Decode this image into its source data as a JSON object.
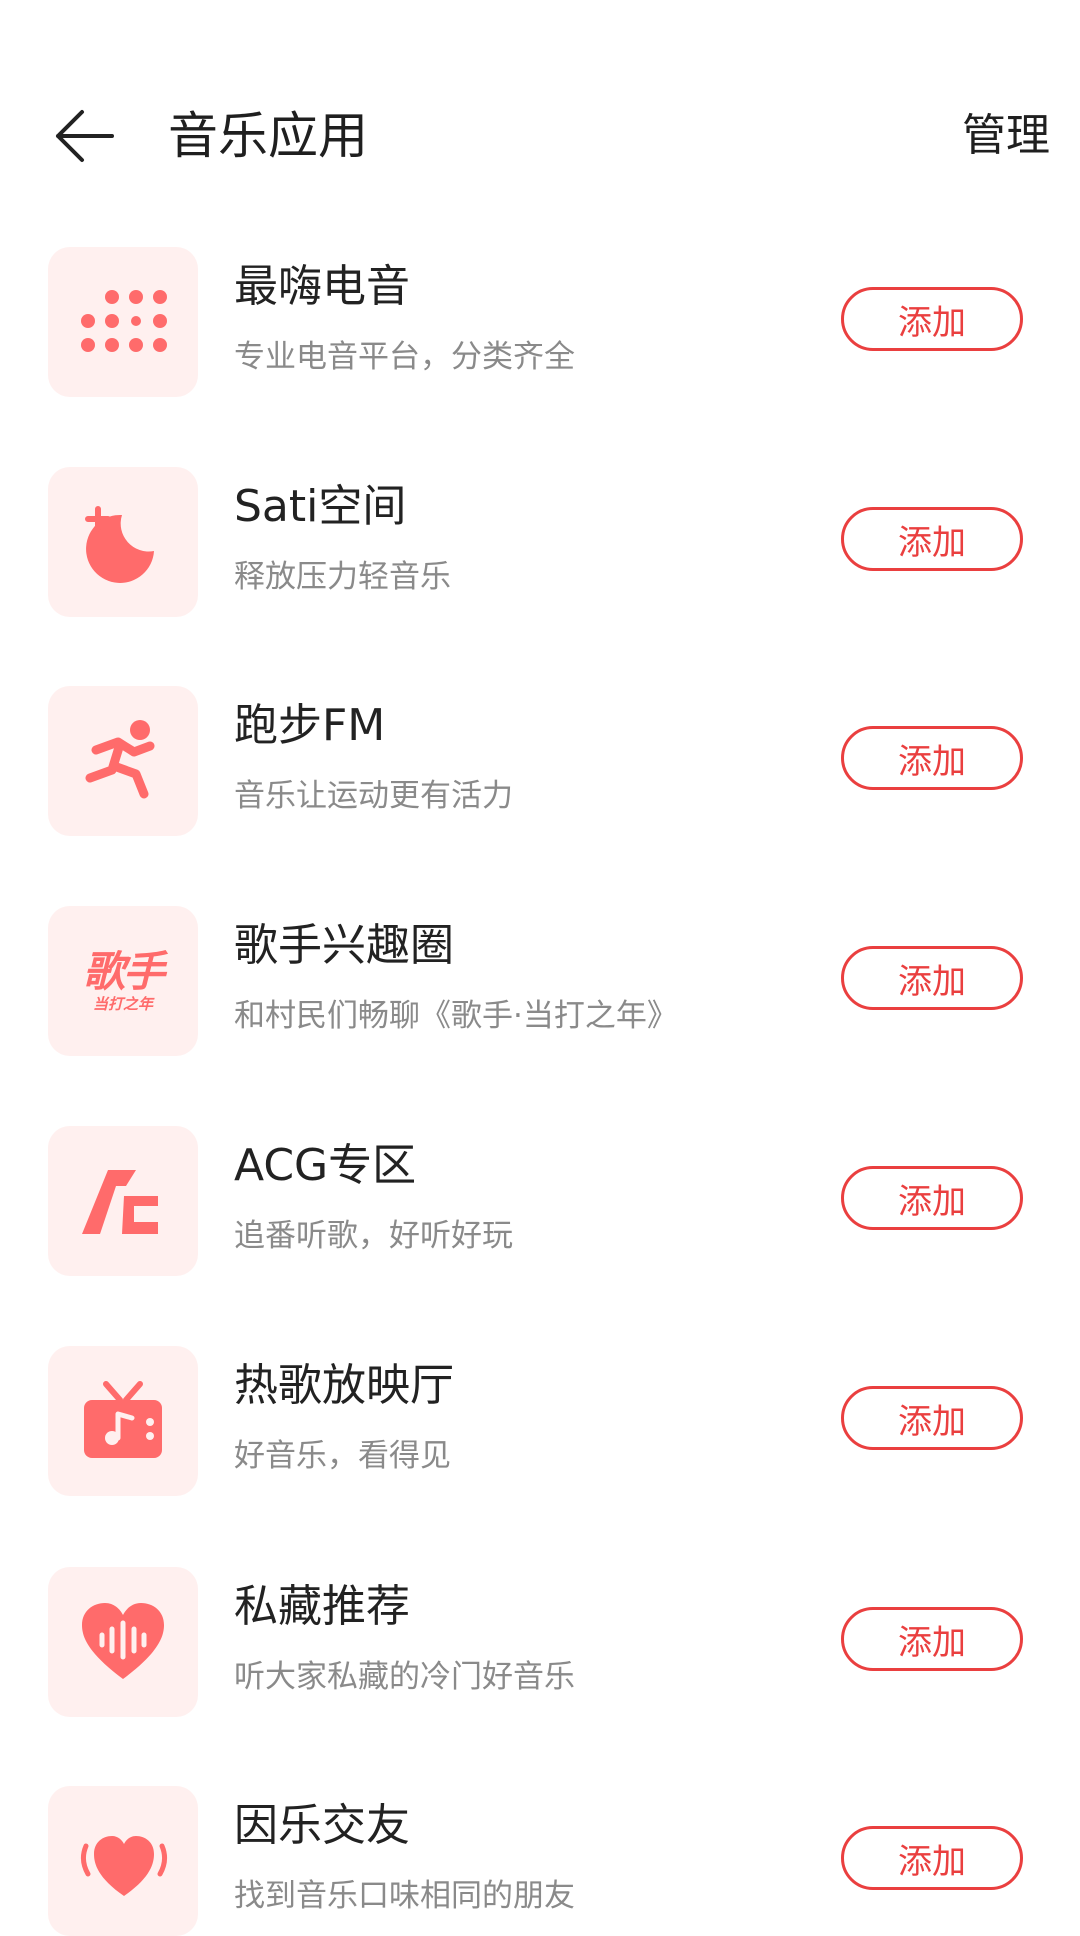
{
  "header": {
    "title": "音乐应用",
    "manage_label": "管理"
  },
  "accent_color": "#ea3f3f",
  "icon_color": "#ff6b6b",
  "tile_color": "#fff0ef",
  "apps": [
    {
      "name": "最嗨电音",
      "desc": "专业电音平台，分类齐全",
      "add_label": "添加",
      "icon": "dots-grid-icon"
    },
    {
      "name": "Sati空间",
      "desc": "释放压力轻音乐",
      "add_label": "添加",
      "icon": "moon-plus-icon"
    },
    {
      "name": "跑步FM",
      "desc": "音乐让运动更有活力",
      "add_label": "添加",
      "icon": "running-person-icon"
    },
    {
      "name": "歌手兴趣圈",
      "desc": "和村民们畅聊《歌手·当打之年》",
      "add_label": "添加",
      "icon": "singer-logo-icon",
      "icon_text": "歌手",
      "icon_subtext": "当打之年"
    },
    {
      "name": "ACG专区",
      "desc": "追番听歌，好听好玩",
      "add_label": "添加",
      "icon": "acg-logo-icon"
    },
    {
      "name": "热歌放映厅",
      "desc": "好音乐，看得见",
      "add_label": "添加",
      "icon": "tv-music-icon"
    },
    {
      "name": "私藏推荐",
      "desc": "听大家私藏的冷门好音乐",
      "add_label": "添加",
      "icon": "heart-wave-icon"
    },
    {
      "name": "因乐交友",
      "desc": "找到音乐口味相同的朋友",
      "add_label": "添加",
      "icon": "heart-sound-icon"
    }
  ]
}
